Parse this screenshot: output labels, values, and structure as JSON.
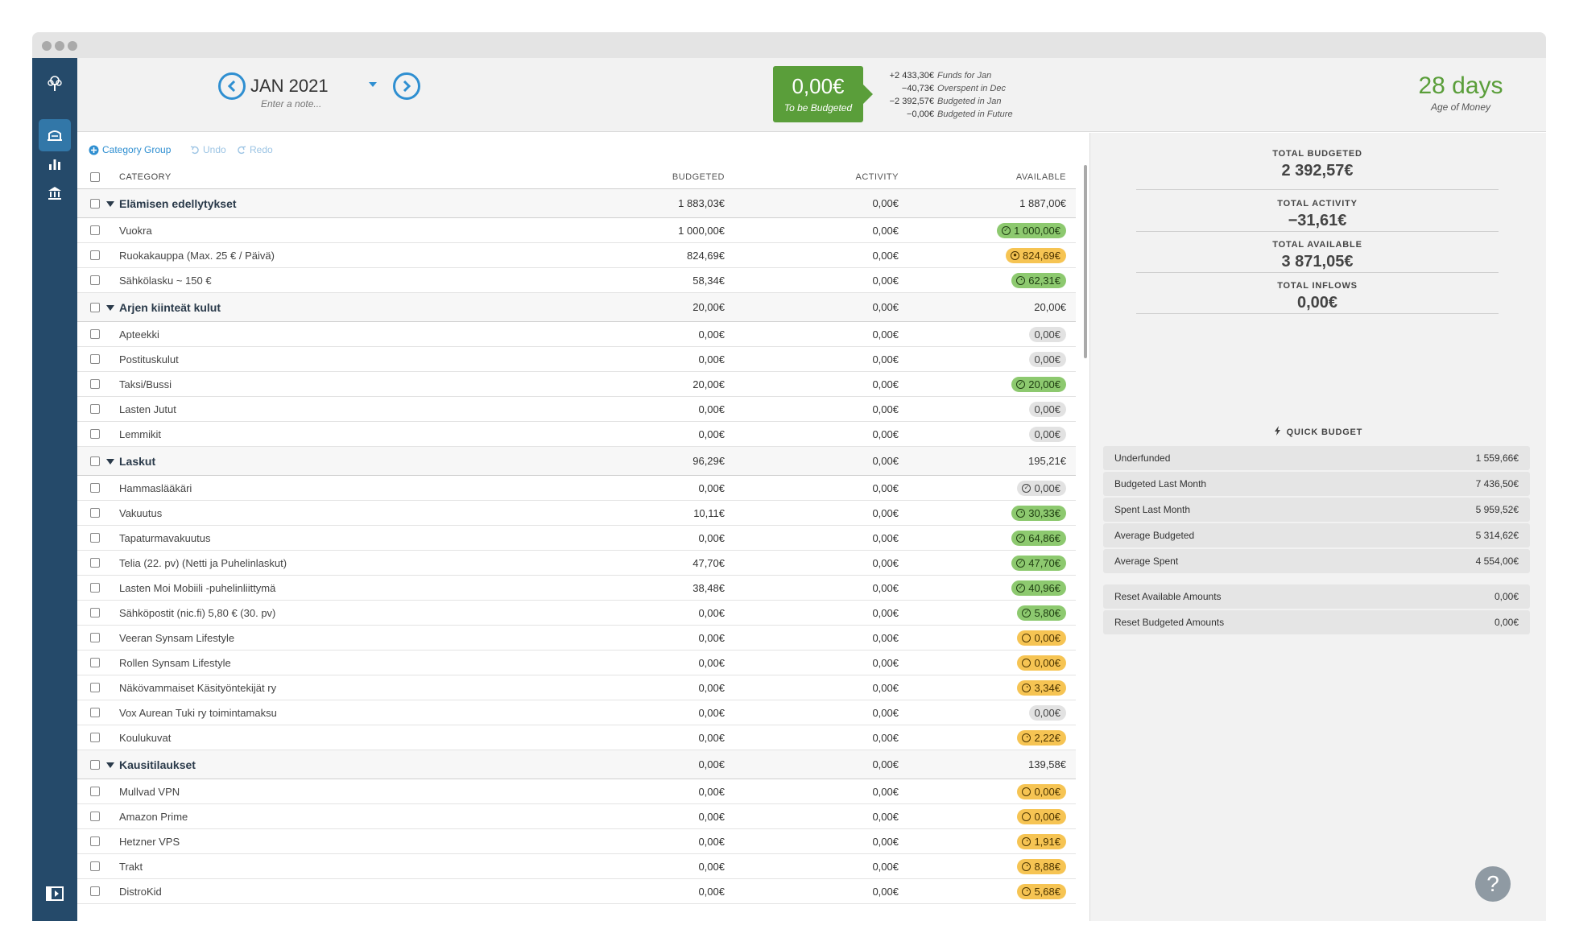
{
  "header": {
    "month": "JAN 2021",
    "note_placeholder": "Enter a note...",
    "to_be_budgeted": {
      "amount": "0,00€",
      "label": "To be Budgeted"
    },
    "funds": [
      {
        "amount": "+2 433,30€",
        "label": "Funds for Jan"
      },
      {
        "amount": "−40,73€",
        "label": "Overspent in Dec"
      },
      {
        "amount": "−2 392,57€",
        "label": "Budgeted in Jan"
      },
      {
        "amount": "−0,00€",
        "label": "Budgeted in Future"
      }
    ],
    "age_of_money": {
      "value": "28 days",
      "label": "Age of Money"
    }
  },
  "toolbar": {
    "category_group": "Category Group",
    "undo": "Undo",
    "redo": "Redo"
  },
  "table": {
    "columns": {
      "category": "CATEGORY",
      "budgeted": "BUDGETED",
      "activity": "ACTIVITY",
      "available": "AVAILABLE"
    },
    "rows": [
      {
        "type": "group",
        "name": "Elämisen edellytykset",
        "budgeted": "1 883,03€",
        "activity": "0,00€",
        "available": "1 887,00€"
      },
      {
        "type": "item",
        "name": "Vuokra",
        "budgeted": "1 000,00€",
        "activity": "0,00€",
        "available": "1 000,00€",
        "pill": "green",
        "icon": "check"
      },
      {
        "type": "item",
        "name": "Ruokakauppa (Max. 25 € / Päivä)",
        "budgeted": "824,69€",
        "activity": "0,00€",
        "available": "824,69€",
        "pill": "yellow",
        "icon": "full"
      },
      {
        "type": "item",
        "name": "Sähkölasku ~ 150 €",
        "budgeted": "58,34€",
        "activity": "0,00€",
        "available": "62,31€",
        "pill": "green",
        "icon": "partial"
      },
      {
        "type": "group",
        "name": "Arjen kiinteät kulut",
        "budgeted": "20,00€",
        "activity": "0,00€",
        "available": "20,00€"
      },
      {
        "type": "item",
        "name": "Apteekki",
        "budgeted": "0,00€",
        "activity": "0,00€",
        "available": "0,00€",
        "pill": "gray",
        "icon": ""
      },
      {
        "type": "item",
        "name": "Postituskulut",
        "budgeted": "0,00€",
        "activity": "0,00€",
        "available": "0,00€",
        "pill": "gray",
        "icon": ""
      },
      {
        "type": "item",
        "name": "Taksi/Bussi",
        "budgeted": "20,00€",
        "activity": "0,00€",
        "available": "20,00€",
        "pill": "green",
        "icon": "check"
      },
      {
        "type": "item",
        "name": "Lasten Jutut",
        "budgeted": "0,00€",
        "activity": "0,00€",
        "available": "0,00€",
        "pill": "gray",
        "icon": ""
      },
      {
        "type": "item",
        "name": "Lemmikit",
        "budgeted": "0,00€",
        "activity": "0,00€",
        "available": "0,00€",
        "pill": "gray",
        "icon": ""
      },
      {
        "type": "group",
        "name": "Laskut",
        "budgeted": "96,29€",
        "activity": "0,00€",
        "available": "195,21€"
      },
      {
        "type": "item",
        "name": "Hammaslääkäri",
        "budgeted": "0,00€",
        "activity": "0,00€",
        "available": "0,00€",
        "pill": "gray",
        "icon": "check"
      },
      {
        "type": "item",
        "name": "Vakuutus",
        "budgeted": "10,11€",
        "activity": "0,00€",
        "available": "30,33€",
        "pill": "green",
        "icon": "partial"
      },
      {
        "type": "item",
        "name": "Tapaturmavakuutus",
        "budgeted": "0,00€",
        "activity": "0,00€",
        "available": "64,86€",
        "pill": "green",
        "icon": "check"
      },
      {
        "type": "item",
        "name": "Telia (22. pv) (Netti ja Puhelinlaskut)",
        "budgeted": "47,70€",
        "activity": "0,00€",
        "available": "47,70€",
        "pill": "green",
        "icon": "check"
      },
      {
        "type": "item",
        "name": "Lasten Moi Mobiili -puhelinliittymä",
        "budgeted": "38,48€",
        "activity": "0,00€",
        "available": "40,96€",
        "pill": "green",
        "icon": "check"
      },
      {
        "type": "item",
        "name": "Sähköpostit (nic.fi) 5,80 € (30. pv)",
        "budgeted": "0,00€",
        "activity": "0,00€",
        "available": "5,80€",
        "pill": "green",
        "icon": "check"
      },
      {
        "type": "item",
        "name": "Veeran Synsam Lifestyle",
        "budgeted": "0,00€",
        "activity": "0,00€",
        "available": "0,00€",
        "pill": "yellow",
        "icon": "empty"
      },
      {
        "type": "item",
        "name": "Rollen Synsam Lifestyle",
        "budgeted": "0,00€",
        "activity": "0,00€",
        "available": "0,00€",
        "pill": "yellow",
        "icon": "empty"
      },
      {
        "type": "item",
        "name": "Näkövammaiset Käsityöntekijät ry",
        "budgeted": "0,00€",
        "activity": "0,00€",
        "available": "3,34€",
        "pill": "yellow",
        "icon": "partial"
      },
      {
        "type": "item",
        "name": "Vox Aurean Tuki ry toimintamaksu",
        "budgeted": "0,00€",
        "activity": "0,00€",
        "available": "0,00€",
        "pill": "gray",
        "icon": ""
      },
      {
        "type": "item",
        "name": "Koulukuvat",
        "budgeted": "0,00€",
        "activity": "0,00€",
        "available": "2,22€",
        "pill": "yellow",
        "icon": "partial"
      },
      {
        "type": "group",
        "name": "Kausitilaukset",
        "budgeted": "0,00€",
        "activity": "0,00€",
        "available": "139,58€"
      },
      {
        "type": "item",
        "name": "Mullvad VPN",
        "budgeted": "0,00€",
        "activity": "0,00€",
        "available": "0,00€",
        "pill": "yellow",
        "icon": "empty"
      },
      {
        "type": "item",
        "name": "Amazon Prime",
        "budgeted": "0,00€",
        "activity": "0,00€",
        "available": "0,00€",
        "pill": "yellow",
        "icon": "empty"
      },
      {
        "type": "item",
        "name": "Hetzner VPS",
        "budgeted": "0,00€",
        "activity": "0,00€",
        "available": "1,91€",
        "pill": "yellow",
        "icon": "partial"
      },
      {
        "type": "item",
        "name": "Trakt",
        "budgeted": "0,00€",
        "activity": "0,00€",
        "available": "8,88€",
        "pill": "yellow",
        "icon": "partial"
      },
      {
        "type": "item",
        "name": "DistroKid",
        "budgeted": "0,00€",
        "activity": "0,00€",
        "available": "5,68€",
        "pill": "yellow",
        "icon": "partial"
      }
    ]
  },
  "inspector": {
    "totals": [
      {
        "label": "TOTAL BUDGETED",
        "value": "2 392,57€"
      },
      {
        "label": "TOTAL ACTIVITY",
        "value": "−31,61€"
      },
      {
        "label": "TOTAL AVAILABLE",
        "value": "3 871,05€"
      },
      {
        "label": "TOTAL INFLOWS",
        "value": "0,00€"
      }
    ],
    "quick_budget_title": "QUICK BUDGET",
    "quick_budget": [
      {
        "label": "Underfunded",
        "value": "1 559,66€"
      },
      {
        "label": "Budgeted Last Month",
        "value": "7 436,50€"
      },
      {
        "label": "Spent Last Month",
        "value": "5 959,52€"
      },
      {
        "label": "Average Budgeted",
        "value": "5 314,62€"
      },
      {
        "label": "Average Spent",
        "value": "4 554,00€"
      }
    ],
    "reset": [
      {
        "label": "Reset Available Amounts",
        "value": "0,00€"
      },
      {
        "label": "Reset Budgeted Amounts",
        "value": "0,00€"
      }
    ]
  },
  "help": "?",
  "colors": {
    "sidebar": "#254a6a",
    "accent": "#2f8fd1",
    "positive": "#5a9e3a",
    "pill_green": "#8dc96f",
    "pill_yellow": "#f6c453",
    "pill_gray": "#e2e2e2"
  },
  "icons": {
    "logo": "tree-icon",
    "budget": "budget-icon",
    "reports": "bar-chart-icon",
    "accounts": "bank-icon",
    "collapse": "collapse-sidebar-icon"
  }
}
